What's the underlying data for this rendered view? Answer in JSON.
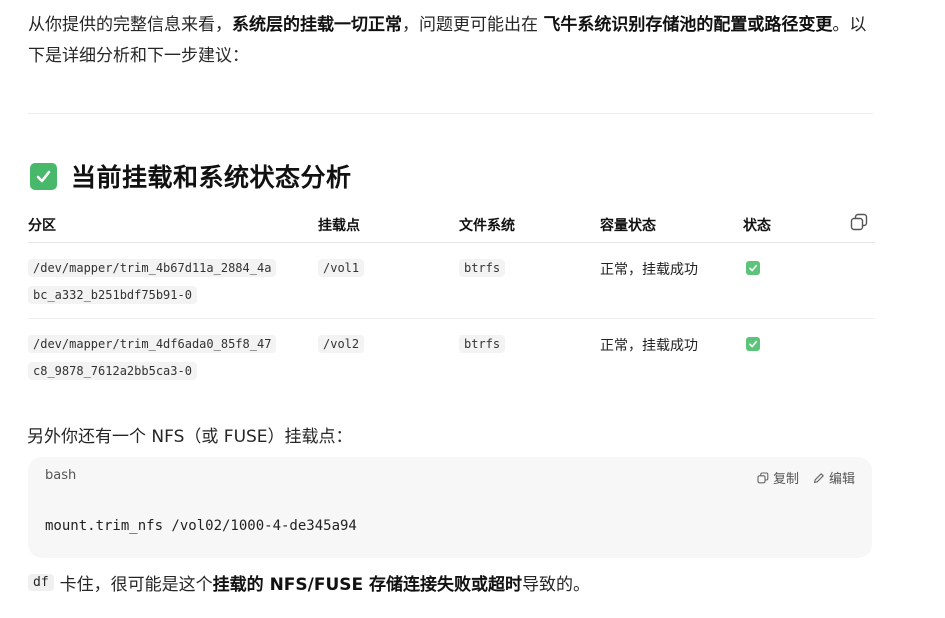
{
  "intro": {
    "part1": "从你提供的完整信息来看，",
    "bold1": "系统层的挂载一切正常",
    "part2": "，问题更可能出在 ",
    "bold2": "飞牛系统识别存储池的配置或路径变更",
    "part3": "。以下是详细分析和下一步建议："
  },
  "section": {
    "icon": "check-mark-button",
    "title": "当前挂载和系统状态分析"
  },
  "table": {
    "headers": [
      "分区",
      "挂载点",
      "文件系统",
      "容量状态",
      "状态"
    ],
    "rows": [
      {
        "device_line1": "/dev/mapper/trim_4b67d11a_2884_4a",
        "device_line2": "bc_a332_b251bdf75b91-0",
        "mount": "/vol1",
        "fs": "btrfs",
        "capacity": "正常，挂载成功",
        "status_icon": "check-mark-button"
      },
      {
        "device_line1": "/dev/mapper/trim_4df6ada0_85f8_47",
        "device_line2": "c8_9878_7612a2bb5ca3-0",
        "mount": "/vol2",
        "fs": "btrfs",
        "capacity": "正常，挂载成功",
        "status_icon": "check-mark-button"
      }
    ]
  },
  "para": "另外你还有一个 NFS（或 FUSE）挂载点：",
  "codeblock": {
    "lang": "bash",
    "copy_label": "复制",
    "edit_label": "编辑",
    "code": "mount.trim_nfs /vol02/1000-4-de345a94"
  },
  "last": {
    "inline_code": "df",
    "part1": "卡住，很可能是这个 ",
    "bold": "挂载的 NFS/FUSE 存储连接失败或超时",
    "part2": " 导致的。"
  },
  "colors": {
    "check_green": "#48b86a",
    "code_bg": "#f7f7f8"
  }
}
